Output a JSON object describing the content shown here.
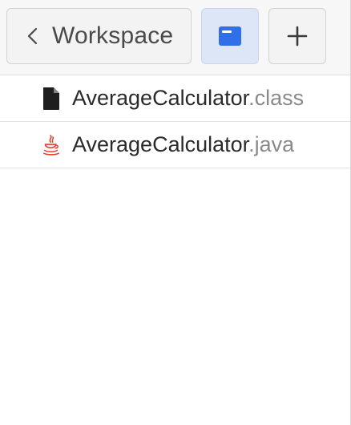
{
  "toolbar": {
    "back_label": "Workspace",
    "back_icon": "chevron-left-icon",
    "view_icon": "window-icon",
    "add_icon": "plus-icon",
    "accent_color": "#2f6fe8"
  },
  "files": [
    {
      "base": "AverageCalculator",
      "ext": ".class",
      "icon": "document-icon"
    },
    {
      "base": "AverageCalculator",
      "ext": ".java",
      "icon": "java-icon"
    }
  ]
}
